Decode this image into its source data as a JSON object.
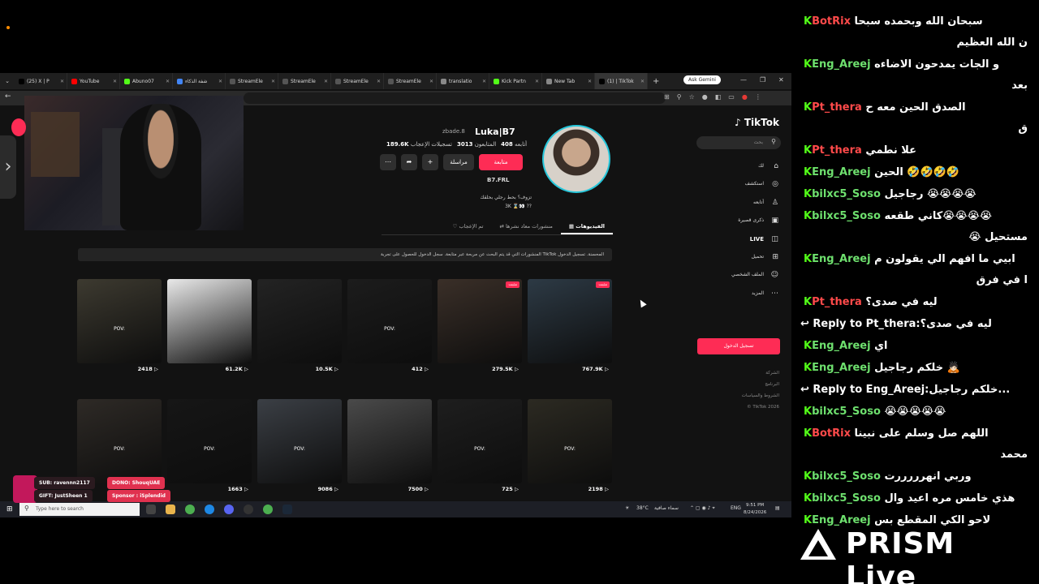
{
  "browser": {
    "tabs": [
      {
        "label": "(25) X | P",
        "color": "#000000"
      },
      {
        "label": "YouTube",
        "color": "#ff0000"
      },
      {
        "label": "Abuno07",
        "color": "#53fc18"
      },
      {
        "label": "شفة الذكاء",
        "color": "#4285f4"
      },
      {
        "label": "StreamEle",
        "color": "#555555"
      },
      {
        "label": "StreamEle",
        "color": "#555555"
      },
      {
        "label": "StreamEle",
        "color": "#555555"
      },
      {
        "label": "StreamEle",
        "color": "#555555"
      },
      {
        "label": "translatio",
        "color": "#888888"
      },
      {
        "label": "Kick Partn",
        "color": "#53fc18"
      },
      {
        "label": "New Tab",
        "color": "#888888"
      },
      {
        "label": "(1) | TikTok",
        "color": "#000000"
      }
    ],
    "active_tab_index": 11,
    "ask_gemini": "Ask Gemini"
  },
  "tiktok": {
    "logo": "TikTok",
    "search_placeholder": "بحث",
    "nav": [
      {
        "label": "لك",
        "icon": "home-icon"
      },
      {
        "label": "استكشف",
        "icon": "compass-icon"
      },
      {
        "label": "أتابعه",
        "icon": "user-follow-icon"
      },
      {
        "label": "ذكرى قصيرة",
        "icon": "video-icon"
      },
      {
        "label": "LIVE",
        "icon": "live-icon"
      },
      {
        "label": "تحميل",
        "icon": "upload-icon"
      },
      {
        "label": "الملف الشخصي",
        "icon": "profile-icon"
      },
      {
        "label": "المزيد",
        "icon": "more-icon"
      }
    ],
    "login_button": "تسجيل الدخول",
    "footer": [
      "الشركة",
      "البرنامج",
      "الشروط والسياسات",
      "© TikTok 2026"
    ],
    "profile": {
      "username": "Luka|B7",
      "handle": "zbade.8",
      "following_count": "408",
      "following_label": "أتابعه",
      "followers_count": "3013",
      "followers_label": "المتابعون",
      "likes_count": "189.6K",
      "likes_label": "تسجيلات الإعجاب",
      "follow_button": "متابعة",
      "message_button": "مراسلة",
      "bio_name": "B7.FRL",
      "bio_line1": "تزوف؟ بحط رجلي بحلقك",
      "bio_line2": "3K ⌛👀 ??"
    },
    "tabs": [
      "الفيديوهات",
      "منشورات معاد نشرها",
      "تم الإعجاب"
    ],
    "notice": "المنشورات التي قد يتم البحث عن مربحة عبر متابعة. سجل الدخول للحصول على تجربة TikTok المحسنة. تسجيل الدخول",
    "notice_link": "تسجيل الدخول",
    "videos": [
      {
        "views": "767.9K",
        "pinned": "مثبت",
        "pov": ""
      },
      {
        "views": "279.5K",
        "pinned": "مثبت",
        "pov": ""
      },
      {
        "views": "412",
        "pinned": "",
        "pov": "POV:"
      },
      {
        "views": "10.5K",
        "pinned": "",
        "pov": ""
      },
      {
        "views": "61.2K",
        "pinned": "",
        "pov": ""
      },
      {
        "views": "2418",
        "pinned": "",
        "pov": "POV:"
      },
      {
        "views": "2198",
        "pinned": "",
        "pov": "POV:"
      },
      {
        "views": "725",
        "pinned": "",
        "pov": "POV:"
      },
      {
        "views": "7500",
        "pinned": "",
        "pov": ""
      },
      {
        "views": "9086",
        "pinned": "",
        "pov": "POV:"
      },
      {
        "views": "1663",
        "pinned": "",
        "pov": "POV:"
      },
      {
        "views": "",
        "pinned": "",
        "pov": "POV:"
      }
    ]
  },
  "alerts": {
    "sub": "SUB: ravennn2117",
    "gift": "GIFT: JustSheen 1",
    "dono": "DONO: ShouqUAE",
    "sponsor": "Sponsor : iSplendid"
  },
  "taskbar": {
    "search_placeholder": "Type here to search",
    "weather": "38°C",
    "weather_text": "سماء صافية",
    "lang": "ENG",
    "time": "9:51 PM",
    "date": "8/24/2026"
  },
  "chat": [
    {
      "user": "BotRix",
      "user_color": "#ff4a4a",
      "text": "سبحان الله وبحمده سبحا",
      "cont": "ن الله العظيم"
    },
    {
      "user": "Eng_Areej",
      "user_color": "#6ee06e",
      "text": "و الجات يمدحون الاضاءه",
      "cont": "بعد"
    },
    {
      "user": "Pt_thera",
      "user_color": "#ff4a4a",
      "text": "الصدق الحين معه ح",
      "cont": "ق"
    },
    {
      "user": "Pt_thera",
      "user_color": "#ff4a4a",
      "text": "علا نطمي",
      "cont": ""
    },
    {
      "user": "Eng_Areej",
      "user_color": "#6ee06e",
      "text": "الحين 🤣🤣🤣🤣",
      "cont": ""
    },
    {
      "user": "bilxc5_Soso",
      "user_color": "#6ee06e",
      "text": "رجاجيل 😭😭😭😭",
      "cont": ""
    },
    {
      "user": "bilxc5_Soso",
      "user_color": "#6ee06e",
      "text": "كاني طقعه😭😭😭😭",
      "cont": "مستحيل 😭"
    },
    {
      "user": "Eng_Areej",
      "user_color": "#6ee06e",
      "text": "ابيي ما افهم الي يقولون م",
      "cont": "ا في فرق"
    },
    {
      "user": "Pt_thera",
      "user_color": "#ff4a4a",
      "text": "ليه في صدى؟",
      "cont": ""
    },
    {
      "reply": "Reply to Pt_thera:ليه في صدى؟"
    },
    {
      "user": "Eng_Areej",
      "user_color": "#6ee06e",
      "text": "اي",
      "cont": ""
    },
    {
      "user": "Eng_Areej",
      "user_color": "#6ee06e",
      "text": "خلكم رجاجيل 🙇🏻",
      "cont": ""
    },
    {
      "reply": "Reply to Eng_Areej:خلكم رجاجيل..."
    },
    {
      "user": "bilxc5_Soso",
      "user_color": "#6ee06e",
      "text": "😭😭😭😭😭",
      "cont": ""
    },
    {
      "user": "BotRix",
      "user_color": "#ff4a4a",
      "text": "اللهم صل وسلم على نبينا",
      "cont": "محمد"
    },
    {
      "user": "bilxc5_Soso",
      "user_color": "#6ee06e",
      "text": "وربي انهرررررت",
      "cont": ""
    },
    {
      "user": "bilxc5_Soso",
      "user_color": "#6ee06e",
      "text": "هذي خامس مره اعيد وال",
      "cont": ""
    },
    {
      "user": "Eng_Areej",
      "user_color": "#6ee06e",
      "text": "لاحو الكي المقطع بس",
      "cont": ""
    }
  ],
  "watermark": "PRISM Live"
}
